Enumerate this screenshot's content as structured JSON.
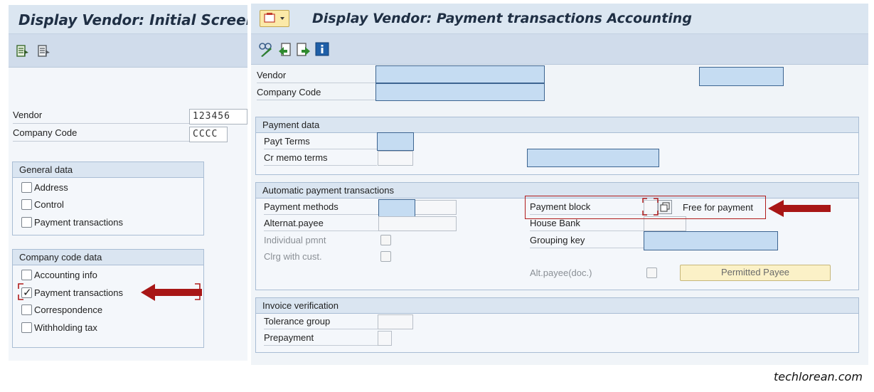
{
  "left_screen": {
    "title": "Display Vendor:  Initial Screen",
    "vendor_label": "Vendor",
    "vendor_value": "123456",
    "company_code_label": "Company Code",
    "company_code_value": "CCCC",
    "general_data": {
      "title": "General data",
      "items": [
        {
          "label": "Address",
          "checked": false
        },
        {
          "label": "Control",
          "checked": false
        },
        {
          "label": "Payment transactions",
          "checked": false
        }
      ]
    },
    "company_code_data": {
      "title": "Company code data",
      "items": [
        {
          "label": "Accounting info",
          "checked": false
        },
        {
          "label": "Payment transactions",
          "checked": true
        },
        {
          "label": "Correspondence",
          "checked": false
        },
        {
          "label": "Withholding tax",
          "checked": false
        }
      ]
    }
  },
  "right_screen": {
    "title": "Display Vendor: Payment transactions Accounting",
    "vendor_label": "Vendor",
    "company_code_label": "Company Code",
    "payment_data": {
      "title": "Payment data",
      "payt_terms_label": "Payt Terms",
      "cr_memo_terms_label": "Cr memo terms"
    },
    "auto_payment": {
      "title": "Automatic payment transactions",
      "payment_methods_label": "Payment methods",
      "alternat_payee_label": "Alternat.payee",
      "individual_pmnt_label": "Individual pmnt",
      "clrg_with_cust_label": "Clrg with cust.",
      "payment_block_label": "Payment block",
      "payment_block_text": "Free for payment",
      "house_bank_label": "House Bank",
      "grouping_key_label": "Grouping key",
      "alt_payee_doc_label": "Alt.payee(doc.)",
      "permitted_payee_button": "Permitted Payee"
    },
    "invoice_verification": {
      "title": "Invoice verification",
      "tolerance_group_label": "Tolerance group",
      "prepayment_label": "Prepayment"
    }
  },
  "watermark": "techlorean.com",
  "colors": {
    "accent_red": "#a81616",
    "field_blue": "#c5dcf2",
    "field_border": "#3d6591"
  }
}
